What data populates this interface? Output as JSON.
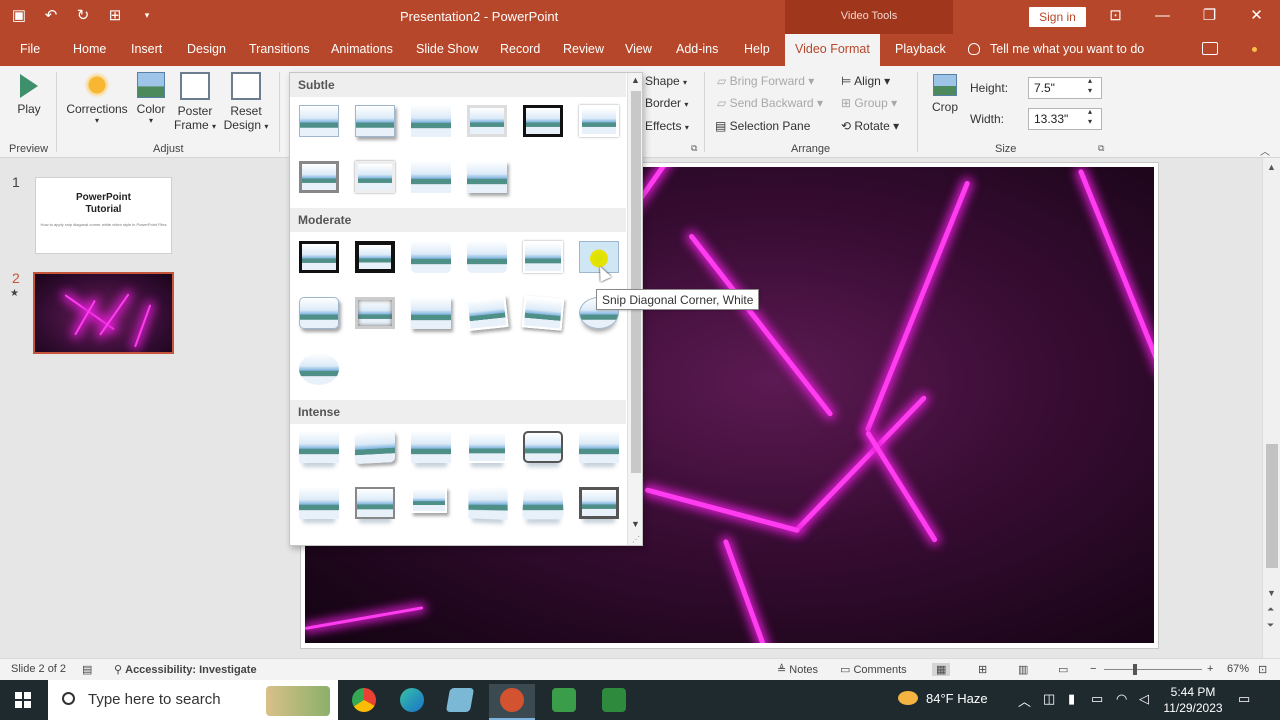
{
  "titlebar": {
    "title": "Presentation2  -  PowerPoint",
    "context_group": "Video Tools",
    "sign_in": "Sign in"
  },
  "tabs": [
    "File",
    "Home",
    "Insert",
    "Design",
    "Transitions",
    "Animations",
    "Slide Show",
    "Record",
    "Review",
    "View",
    "Add-ins",
    "Help",
    "Video Format",
    "Playback"
  ],
  "active_tab": "Video Format",
  "tell_me": "Tell me what you want to do",
  "ribbon": {
    "preview": {
      "play": "Play",
      "group": "Preview"
    },
    "adjust": {
      "corrections": "Corrections",
      "color": "Color",
      "poster1": "Poster",
      "poster2": "Frame",
      "reset1": "Reset",
      "reset2": "Design",
      "group": "Adjust"
    },
    "video_styles": {
      "shape": "Shape",
      "border": "Border",
      "effects": "Effects"
    },
    "arrange": {
      "bring_forward": "Bring Forward",
      "send_backward": "Send Backward",
      "selection_pane": "Selection Pane",
      "align": "Align",
      "group_btn": "Group",
      "rotate": "Rotate",
      "group": "Arrange"
    },
    "size": {
      "crop": "Crop",
      "height_label": "Height:",
      "height_value": "7.5\"",
      "width_label": "Width:",
      "width_value": "13.33\"",
      "group": "Size"
    }
  },
  "slides": {
    "thumb1_num": "1",
    "thumb1_title1": "PowerPoint",
    "thumb1_title2": "Tutorial",
    "thumb1_subtitle": "How to apply snip diagonal corner white video style in PowerPoint Files",
    "thumb2_num": "2"
  },
  "gallery": {
    "sections": [
      "Subtle",
      "Moderate",
      "Intense"
    ],
    "tooltip": "Snip Diagonal Corner, White"
  },
  "statusbar": {
    "slide_info": "Slide 2 of 2",
    "accessibility": "Accessibility: Investigate",
    "notes": "Notes",
    "comments": "Comments",
    "zoom": "67%"
  },
  "taskbar": {
    "search_placeholder": "Type here to search",
    "weather": "84°F  Haze",
    "time": "5:44 PM",
    "date": "11/29/2023"
  },
  "colors": {
    "accent": "#b7472a",
    "neon": "#ff3cf0"
  }
}
